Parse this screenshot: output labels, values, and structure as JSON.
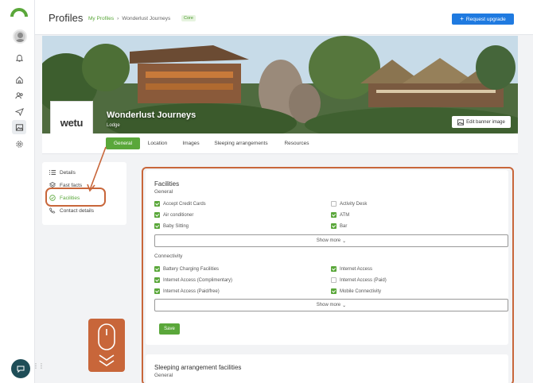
{
  "header": {
    "title": "Profiles",
    "breadcrumb_link": "My Profiles",
    "breadcrumb_sep": "›",
    "breadcrumb_current": "Wonderlust Journeys",
    "badge": "Core",
    "upgrade_label": "Request upgrade"
  },
  "property": {
    "logo_text": "wetu",
    "name": "Wonderlust Journeys",
    "type": "Lodge",
    "edit_banner_label": "Edit banner image"
  },
  "tabs": [
    {
      "label": "General"
    },
    {
      "label": "Location"
    },
    {
      "label": "Images"
    },
    {
      "label": "Sleeping arrangements"
    },
    {
      "label": "Resources"
    }
  ],
  "sidenav": [
    {
      "label": "Details",
      "icon": "list-icon"
    },
    {
      "label": "Fast facts",
      "icon": "layers-icon"
    },
    {
      "label": "Facilities",
      "icon": "check-circle-icon"
    },
    {
      "label": "Contact details",
      "icon": "phone-icon"
    }
  ],
  "facilities": {
    "title": "Facilities",
    "general_heading": "General",
    "general_items": [
      {
        "label": "Accept Credit Cards",
        "checked": true
      },
      {
        "label": "Activity Desk",
        "checked": false
      },
      {
        "label": "Air conditioner",
        "checked": true
      },
      {
        "label": "ATM",
        "checked": true
      },
      {
        "label": "Baby Sitting",
        "checked": true
      },
      {
        "label": "Bar",
        "checked": true
      }
    ],
    "show_more_label": "Show more",
    "connectivity_heading": "Connectivity",
    "connectivity_items": [
      {
        "label": "Battery Charging Facilities",
        "checked": true
      },
      {
        "label": "Internet Access",
        "checked": true
      },
      {
        "label": "Internet Access (Complimentary)",
        "checked": true
      },
      {
        "label": "Internet Access (Paid)",
        "checked": false
      },
      {
        "label": "Internet Access (Paid/free)",
        "checked": true
      },
      {
        "label": "Mobile Connectivity",
        "checked": true
      }
    ],
    "show_more_label_2": "Show more",
    "save_label": "Save"
  },
  "sleeping": {
    "title": "Sleeping arrangement facilities",
    "general_heading": "General"
  },
  "colors": {
    "accent_green": "#5aa73a",
    "primary_blue": "#1f7ae0",
    "annotation_orange": "#c8663a",
    "chat_bubble": "#1e4d57"
  }
}
